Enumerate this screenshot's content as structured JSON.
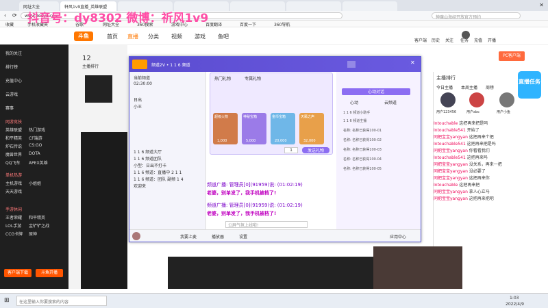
{
  "browser": {
    "tabs": [
      "网址大全",
      "轩风1v9直播_英雄联盟",
      "",
      "",
      "",
      "",
      "",
      "",
      "",
      "",
      ""
    ],
    "address": "www.douyu.com",
    "search_placeholder": "神魔山海经开放官方预约",
    "bookmarks": [
      "收藏",
      "手机收藏夹",
      "谷歌",
      "网址大全",
      "360搜索",
      "游戏中心",
      "百度翻译",
      "百度一下",
      "360导航",
      "微博",
      "新浪"
    ]
  },
  "watermark": "抖音号：dy8302 微博：祈风1v9",
  "douyu": {
    "logo": "斗鱼",
    "nav": [
      "首页",
      "直播",
      "分类",
      "视频",
      "游戏",
      "鱼吧"
    ],
    "sidebar": [
      {
        "label": "我的关注"
      },
      {
        "label": "排行榜"
      },
      {
        "label": "充值中心"
      },
      {
        "label": "云游戏"
      },
      {
        "label": "赛事"
      }
    ],
    "sidebar_cats": [
      "网游竞技",
      "英雄联盟",
      "热门游戏",
      "DOTA2",
      "和平精英",
      "CF端游",
      "DNF",
      "炉石传说",
      "CS:GO",
      "魔兽世界",
      "DOTA",
      "使命召唤",
      "QQ飞车",
      "APEX英雄",
      "单机热游",
      "主机游戏",
      "小姐姐",
      "天天游戏",
      "手游休闲",
      "王者荣耀",
      "和平精英",
      "火影忍者",
      "LOL手游",
      "金铲铲之战",
      "跑跑卡丁车",
      "CCG卡牌",
      "原神",
      "光遇"
    ],
    "sidebar_buttons": [
      "客户端下载",
      "斗鱼开播"
    ],
    "top_right": [
      "客户端",
      "历史",
      "关注",
      "任务",
      "充值",
      "开播"
    ],
    "pc_download": "PC客户端",
    "rank_label": "主播排行",
    "rank_tabs": [
      "今日主播",
      "本周主播",
      "周榜"
    ],
    "rank_users": [
      "用户123456",
      "用户abc",
      "用户小鱼"
    ]
  },
  "yy": {
    "title": "频道2V • 1 1 6 频道",
    "time": "02:30:00",
    "user_info": "当前频道",
    "channel_tree": [
      "1 1 6 频道大厅",
      "1 1 6 频道团队",
      "小型：日出不打卡",
      "1 1 6 频道：直播中 2 1 1",
      "1 1 6 频道：团队 副频 1 4",
      "欢迎来",
      "日出",
      "小王"
    ],
    "gift_tabs": [
      "热门礼物",
      "专属礼物"
    ],
    "gifts": [
      {
        "name": "超级火箭",
        "price": "1,000"
      },
      {
        "name": "神秘宝箱",
        "price": "5,000"
      },
      {
        "name": "金币宝箱",
        "price": "20,000"
      },
      {
        "name": "天籁之声",
        "price": "32,000"
      }
    ],
    "qty": "1",
    "send": "发送礼物",
    "chat": [
      {
        "text": "频道广播: 管理员[0](91959)说: (01:02:19)",
        "color": "#7a00c9"
      },
      {
        "text": "老婆，别单发了，我手机被档了!",
        "color": "#c000c0"
      },
      {
        "text": "频道广播: 管理员[0](91959)说: (01:02:19)",
        "color": "#7a00c9"
      },
      {
        "text": "老婆，别单发了，我手机被档了!",
        "color": "#c000c0"
      }
    ],
    "input_placeholder": "公屏气氛上线啦!",
    "bottom": [
      "我要上麦",
      "播放器",
      "设置"
    ],
    "right_header": "心动对话",
    "right_tabs": [
      "心动",
      "云频道"
    ],
    "right_msgs": [
      "1 1 6 频道小助手",
      "1 1 6 频道主播",
      "名称: 名称已获得100-01",
      "名称: 名称已获得100-02",
      "名称: 名称已获得100-03",
      "名称: 名称已获得100-04",
      "名称: 名称已获得100-05"
    ],
    "apps": "应用中心"
  },
  "douyu_chat": [
    "这把再来把是吗",
    "开始了",
    "这把再来个把",
    "这把再来把是吗",
    "你看看我们",
    "这把再来吗",
    "没关系，再来一把",
    "没必要了",
    "这把再来你",
    "这把再来把",
    "拿人心立马",
    "这把再来把吧"
  ],
  "douyu_users": [
    "Intouchable",
    "Intouchable541",
    "同把宝宝yangyan",
    "Intouchable541",
    "同把宝宝yangyan",
    "Intouchable541",
    "同把宝宝yangyan",
    "同把宝宝yangyan",
    "同把宝宝yangyan",
    "Intouchable",
    "同把宝宝yangyan",
    "同把宝宝yangyan"
  ],
  "taskbar": {
    "search_placeholder": "在这里输入你要搜索的内容",
    "time": "1:03",
    "date": "2022/4/9"
  },
  "badges": {
    "live": "直播",
    "task": "直播任务"
  }
}
